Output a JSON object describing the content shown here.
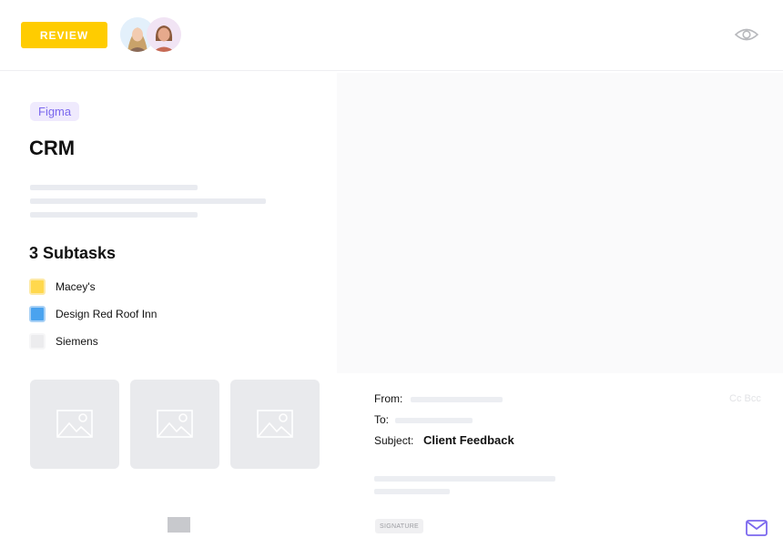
{
  "header": {
    "review_label": "REVIEW",
    "avatars": [
      {
        "name": "avatar-1",
        "bg": "#e3f0fb"
      },
      {
        "name": "avatar-2",
        "bg": "#f1e4f4"
      }
    ],
    "eye_icon": "eye-icon"
  },
  "task": {
    "tag": "Figma",
    "title": "CRM",
    "subtasks_heading": "3 Subtasks",
    "subtasks": [
      {
        "label": "Macey's",
        "color": "#ffd84d",
        "border": "#fde9a6"
      },
      {
        "label": "Design Red Roof Inn",
        "color": "#4aa3ef",
        "border": "#a9d1f5"
      },
      {
        "label": "Siemens",
        "color": "#ececee",
        "border": "#f6f6f7"
      }
    ]
  },
  "attachments": {
    "thumbnails": [
      {
        "icon": "image-placeholder-icon"
      },
      {
        "icon": "image-placeholder-icon"
      },
      {
        "icon": "image-placeholder-icon"
      }
    ]
  },
  "email": {
    "from_label": "From:",
    "to_label": "To:",
    "subject_label": "Subject:",
    "subject_value": "Client Feedback",
    "cc_bcc": "Cc Bcc",
    "signature_label": "SIGNATURE",
    "accent": "#7b68ee"
  }
}
